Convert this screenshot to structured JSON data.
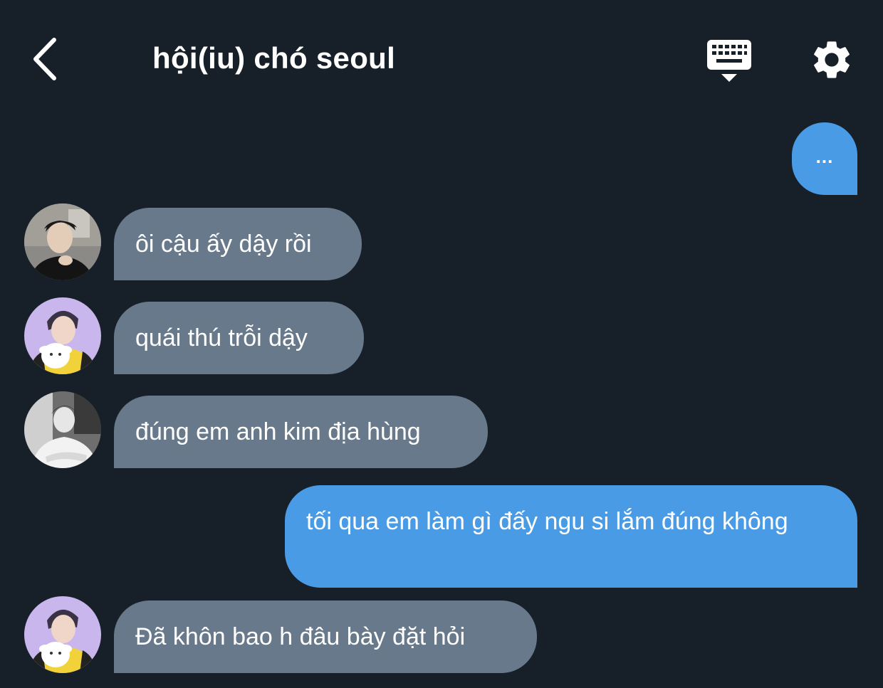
{
  "header": {
    "title": "hội(iu) chó seoul",
    "back_icon": "chevron-left-icon",
    "keyboard_icon": "keyboard-icon",
    "settings_icon": "gear-icon"
  },
  "colors": {
    "background": "#172029",
    "incoming_bubble": "#67798a",
    "outgoing_bubble": "#4a9be6",
    "text": "#ffffff"
  },
  "messages": [
    {
      "direction": "out",
      "text": "..."
    },
    {
      "direction": "in",
      "avatar": "avatar-1",
      "text": "ôi cậu ấy dậy rồi"
    },
    {
      "direction": "in",
      "avatar": "avatar-2",
      "text": "quái thú trỗi dậy"
    },
    {
      "direction": "in",
      "avatar": "avatar-3",
      "text": "đúng em anh kim địa hùng"
    },
    {
      "direction": "out",
      "text": "tối qua em làm gì đấy ngu si lắm đúng không"
    },
    {
      "direction": "in",
      "avatar": "avatar-2",
      "text": "Đã khôn bao h đâu bày đặt hỏi"
    }
  ]
}
